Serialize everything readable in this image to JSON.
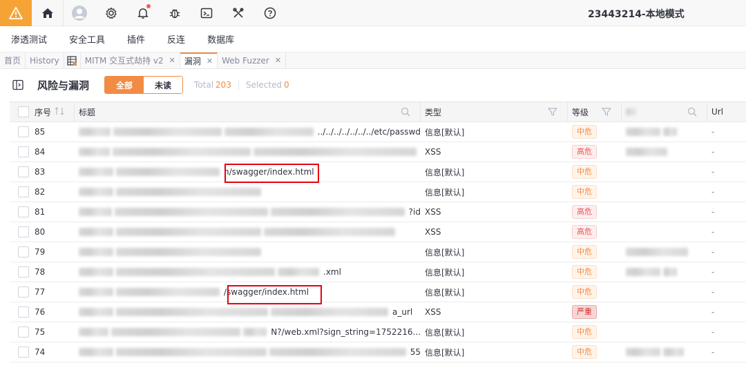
{
  "app": {
    "title": "23443214-本地模式"
  },
  "menu": [
    "渗透测试",
    "安全工具",
    "插件",
    "反连",
    "数据库"
  ],
  "tabs": [
    {
      "label": "首页",
      "closable": false
    },
    {
      "label": "History",
      "closable": false
    },
    {
      "label": "MITM 交互式劫持 v2",
      "closable": true
    },
    {
      "label": "漏洞",
      "closable": true,
      "active": true
    },
    {
      "label": "Web Fuzzer",
      "closable": true
    }
  ],
  "page": {
    "title": "风险与漏洞",
    "filter_all": "全部",
    "filter_unread": "未读",
    "total_label": "Total",
    "total_value": "203",
    "selected_label": "Selected",
    "selected_value": "0"
  },
  "columns": {
    "no": "序号",
    "title": "标题",
    "type": "类型",
    "level": "等级",
    "url": "Url"
  },
  "rows": [
    {
      "no": "85",
      "title_visible": "../../../../../../../etc/passwd",
      "type": "信息[默认]",
      "level": "中危",
      "level_kind": "mid",
      "url": "-"
    },
    {
      "no": "84",
      "title_visible": "",
      "type": "XSS",
      "level": "高危",
      "level_kind": "high",
      "url": "-"
    },
    {
      "no": "83",
      "title_visible": "n/swagger/index.html",
      "type": "信息[默认]",
      "level": "中危",
      "level_kind": "mid",
      "url": "-"
    },
    {
      "no": "82",
      "title_visible": "",
      "type": "信息[默认]",
      "level": "中危",
      "level_kind": "mid",
      "url": "-"
    },
    {
      "no": "81",
      "title_visible": "?id",
      "type": "XSS",
      "level": "高危",
      "level_kind": "high",
      "url": "-"
    },
    {
      "no": "80",
      "title_visible": "",
      "type": "XSS",
      "level": "高危",
      "level_kind": "high",
      "url": "-"
    },
    {
      "no": "79",
      "title_visible": "",
      "type": "信息[默认]",
      "level": "中危",
      "level_kind": "mid",
      "url": "-"
    },
    {
      "no": "78",
      "title_visible": ".xml",
      "type": "信息[默认]",
      "level": "中危",
      "level_kind": "mid",
      "url": "-"
    },
    {
      "no": "77",
      "title_visible": "/swagger/index.html",
      "type": "信息[默认]",
      "level": "中危",
      "level_kind": "mid",
      "url": "-"
    },
    {
      "no": "76",
      "title_visible": "a_url",
      "type": "XSS",
      "level": "严重",
      "level_kind": "crit",
      "url": "-"
    },
    {
      "no": "75",
      "title_visible": "N?/web.xml?sign_string=1752216...",
      "type": "信息[默认]",
      "level": "中危",
      "level_kind": "mid",
      "url": "-"
    },
    {
      "no": "74",
      "title_visible": "55",
      "type": "信息[默认]",
      "level": "中危",
      "level_kind": "mid",
      "url": "-"
    }
  ],
  "colors": {
    "accent": "#f28b44",
    "warn": "#f6a335",
    "highlight_box": "#e60012"
  }
}
